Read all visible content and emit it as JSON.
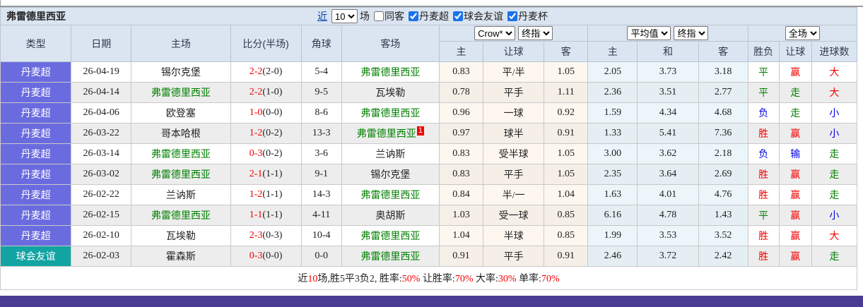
{
  "title_bar": {
    "title": "弗雷德里西亚",
    "near_link": "近",
    "near_select_value": "10",
    "games_suffix": "场",
    "filters": [
      {
        "label": "同客",
        "checked": false
      },
      {
        "label": "丹麦超",
        "checked": true
      },
      {
        "label": "球会友谊",
        "checked": true
      },
      {
        "label": "丹麦杯",
        "checked": true
      }
    ]
  },
  "table": {
    "columns_left": [
      "类型",
      "日期",
      "主场",
      "比分(半场)",
      "角球",
      "客场"
    ],
    "group_odds": {
      "select1": "Crow*",
      "select2": "终指",
      "sub1": "主",
      "sub2": "让球",
      "sub3": "客"
    },
    "group_avg": {
      "select1": "平均值",
      "select2": "终指",
      "sub1": "主",
      "sub2": "和",
      "sub3": "客"
    },
    "group_result": {
      "select1": "全场",
      "sub1": "胜负",
      "sub2": "让球",
      "sub3": "进球数"
    },
    "rows": [
      {
        "league": "丹麦超",
        "league_class": "purple",
        "date": "26-04-19",
        "home": "锡尔克堡",
        "home_class": "dark",
        "score_ft": "2-2",
        "score_ht": "(2-0)",
        "corners": "5-4",
        "away": "弗雷德里西亚",
        "away_class": "self",
        "away_badge": "",
        "odds_home": "0.83",
        "odds_line": "平/半",
        "odds_away": "1.05",
        "avg_home": "2.05",
        "avg_draw": "3.73",
        "avg_away": "3.18",
        "r1": "平",
        "r1c": "green",
        "r2": "赢",
        "r2c": "red",
        "r3": "大",
        "r3c": "red"
      },
      {
        "league": "丹麦超",
        "league_class": "purple",
        "date": "26-04-14",
        "home": "弗雷德里西亚",
        "home_class": "self",
        "score_ft": "2-2",
        "score_ht": "(1-0)",
        "corners": "9-5",
        "away": "瓦埃勒",
        "away_class": "dark",
        "away_badge": "",
        "odds_home": "0.78",
        "odds_line": "平手",
        "odds_away": "1.11",
        "avg_home": "2.36",
        "avg_draw": "3.51",
        "avg_away": "2.77",
        "r1": "平",
        "r1c": "green",
        "r2": "走",
        "r2c": "green",
        "r3": "大",
        "r3c": "red"
      },
      {
        "league": "丹麦超",
        "league_class": "purple",
        "date": "26-04-06",
        "home": "欧登塞",
        "home_class": "dark",
        "score_ft": "1-0",
        "score_ht": "(0-0)",
        "corners": "8-6",
        "away": "弗雷德里西亚",
        "away_class": "self",
        "away_badge": "",
        "odds_home": "0.96",
        "odds_line": "一球",
        "odds_away": "0.92",
        "avg_home": "1.59",
        "avg_draw": "4.34",
        "avg_away": "4.68",
        "r1": "负",
        "r1c": "blue",
        "r2": "走",
        "r2c": "green",
        "r3": "小",
        "r3c": "blue"
      },
      {
        "league": "丹麦超",
        "league_class": "purple",
        "date": "26-03-22",
        "home": "哥本哈根",
        "home_class": "dark",
        "score_ft": "1-2",
        "score_ht": "(0-2)",
        "corners": "13-3",
        "away": "弗雷德里西亚",
        "away_class": "self",
        "away_badge": "1",
        "odds_home": "0.97",
        "odds_line": "球半",
        "odds_away": "0.91",
        "avg_home": "1.33",
        "avg_draw": "5.41",
        "avg_away": "7.36",
        "r1": "胜",
        "r1c": "red",
        "r2": "赢",
        "r2c": "red",
        "r3": "小",
        "r3c": "blue"
      },
      {
        "league": "丹麦超",
        "league_class": "purple",
        "date": "26-03-14",
        "home": "弗雷德里西亚",
        "home_class": "self",
        "score_ft": "0-3",
        "score_ht": "(0-2)",
        "corners": "3-6",
        "away": "兰讷斯",
        "away_class": "dark",
        "away_badge": "",
        "odds_home": "0.83",
        "odds_line": "受半球",
        "odds_away": "1.05",
        "avg_home": "3.00",
        "avg_draw": "3.62",
        "avg_away": "2.18",
        "r1": "负",
        "r1c": "blue",
        "r2": "输",
        "r2c": "blue",
        "r3": "走",
        "r3c": "green"
      },
      {
        "league": "丹麦超",
        "league_class": "purple",
        "date": "26-03-02",
        "home": "弗雷德里西亚",
        "home_class": "self",
        "score_ft": "2-1",
        "score_ht": "(1-1)",
        "corners": "9-1",
        "away": "锡尔克堡",
        "away_class": "dark",
        "away_badge": "",
        "odds_home": "0.83",
        "odds_line": "平手",
        "odds_away": "1.05",
        "avg_home": "2.35",
        "avg_draw": "3.64",
        "avg_away": "2.69",
        "r1": "胜",
        "r1c": "red",
        "r2": "赢",
        "r2c": "red",
        "r3": "走",
        "r3c": "green"
      },
      {
        "league": "丹麦超",
        "league_class": "purple",
        "date": "26-02-22",
        "home": "兰讷斯",
        "home_class": "dark",
        "score_ft": "1-2",
        "score_ht": "(1-1)",
        "corners": "14-3",
        "away": "弗雷德里西亚",
        "away_class": "self",
        "away_badge": "",
        "odds_home": "0.84",
        "odds_line": "半/一",
        "odds_away": "1.04",
        "avg_home": "1.63",
        "avg_draw": "4.01",
        "avg_away": "4.76",
        "r1": "胜",
        "r1c": "red",
        "r2": "赢",
        "r2c": "red",
        "r3": "走",
        "r3c": "green"
      },
      {
        "league": "丹麦超",
        "league_class": "purple",
        "date": "26-02-15",
        "home": "弗雷德里西亚",
        "home_class": "self",
        "score_ft": "1-1",
        "score_ht": "(1-1)",
        "corners": "4-11",
        "away": "奥胡斯",
        "away_class": "dark",
        "away_badge": "",
        "odds_home": "1.03",
        "odds_line": "受一球",
        "odds_away": "0.85",
        "avg_home": "6.16",
        "avg_draw": "4.78",
        "avg_away": "1.43",
        "r1": "平",
        "r1c": "green",
        "r2": "赢",
        "r2c": "red",
        "r3": "小",
        "r3c": "blue"
      },
      {
        "league": "丹麦超",
        "league_class": "purple",
        "date": "26-02-10",
        "home": "瓦埃勒",
        "home_class": "dark",
        "score_ft": "2-3",
        "score_ht": "(0-3)",
        "corners": "10-4",
        "away": "弗雷德里西亚",
        "away_class": "self",
        "away_badge": "",
        "odds_home": "1.04",
        "odds_line": "半球",
        "odds_away": "0.85",
        "avg_home": "1.99",
        "avg_draw": "3.53",
        "avg_away": "3.52",
        "r1": "胜",
        "r1c": "red",
        "r2": "赢",
        "r2c": "red",
        "r3": "大",
        "r3c": "red"
      },
      {
        "league": "球会友谊",
        "league_class": "teal",
        "date": "26-02-03",
        "home": "霍森斯",
        "home_class": "dark",
        "score_ft": "0-3",
        "score_ht": "(0-0)",
        "corners": "0-0",
        "away": "弗雷德里西亚",
        "away_class": "self",
        "away_badge": "",
        "odds_home": "0.91",
        "odds_line": "平手",
        "odds_away": "0.91",
        "avg_home": "2.46",
        "avg_draw": "3.72",
        "avg_away": "2.42",
        "r1": "胜",
        "r1c": "red",
        "r2": "赢",
        "r2c": "red",
        "r3": "走",
        "r3c": "green"
      }
    ]
  },
  "summary": {
    "parts": [
      {
        "t": "近",
        "c": "dark"
      },
      {
        "t": "10",
        "c": "red"
      },
      {
        "t": "场,胜5平3负2, 胜率:",
        "c": "dark"
      },
      {
        "t": "50%",
        "c": "red"
      },
      {
        "t": " 让胜率:",
        "c": "dark"
      },
      {
        "t": "70%",
        "c": "red"
      },
      {
        "t": " 大率:",
        "c": "dark"
      },
      {
        "t": "30%",
        "c": "red"
      },
      {
        "t": " 单率:",
        "c": "dark"
      },
      {
        "t": "70%",
        "c": "red"
      }
    ]
  },
  "colors": {
    "league_purple": "#6b6be0",
    "league_teal": "#12a3a3",
    "header_bg": "#dbe5f1",
    "footer_bar": "#4a3b94",
    "win_red": "#f40000",
    "draw_green": "#008000",
    "lose_blue": "#0000e8"
  }
}
